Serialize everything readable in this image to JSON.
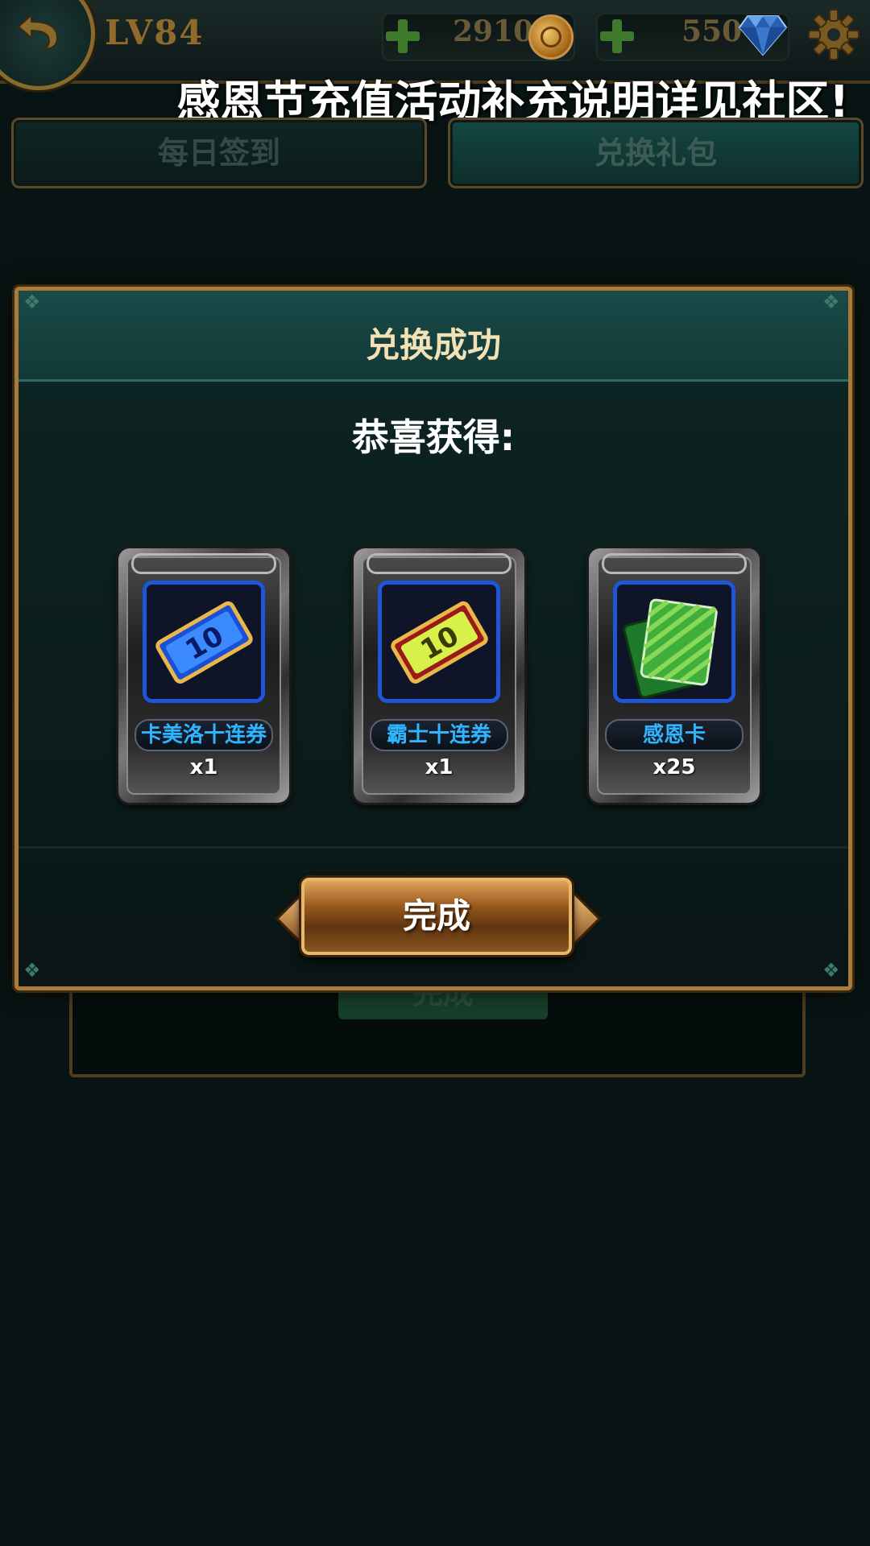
{
  "header": {
    "level": "LV84",
    "gold": "2910",
    "diamonds": "550",
    "icons": {
      "back": "back-arrow-icon",
      "gold": "gold-coin-icon",
      "diamond": "diamond-icon",
      "settings": "gear-icon",
      "add": "plus-icon"
    }
  },
  "announcement": "感恩节充值活动补充说明详见社区!",
  "tabs": [
    {
      "label": "每日签到",
      "active": false
    },
    {
      "label": "兑换礼包",
      "active": true
    }
  ],
  "background_panel": {
    "button_label": "完成"
  },
  "dialog": {
    "title": "兑换成功",
    "message": "恭喜获得:",
    "rewards": [
      {
        "name": "卡美洛十连券",
        "quantity": "x1",
        "icon": "blue-ten-draw-ticket-icon"
      },
      {
        "name": "霸士十连券",
        "quantity": "x1",
        "icon": "red-ten-draw-ticket-icon"
      },
      {
        "name": "感恩卡",
        "quantity": "x25",
        "icon": "green-card-icon"
      }
    ],
    "confirm_label": "完成"
  },
  "colors": {
    "accent_gold": "#a97a3a",
    "item_name": "#2fb4ff",
    "icon_frame": "#1d56d8"
  }
}
